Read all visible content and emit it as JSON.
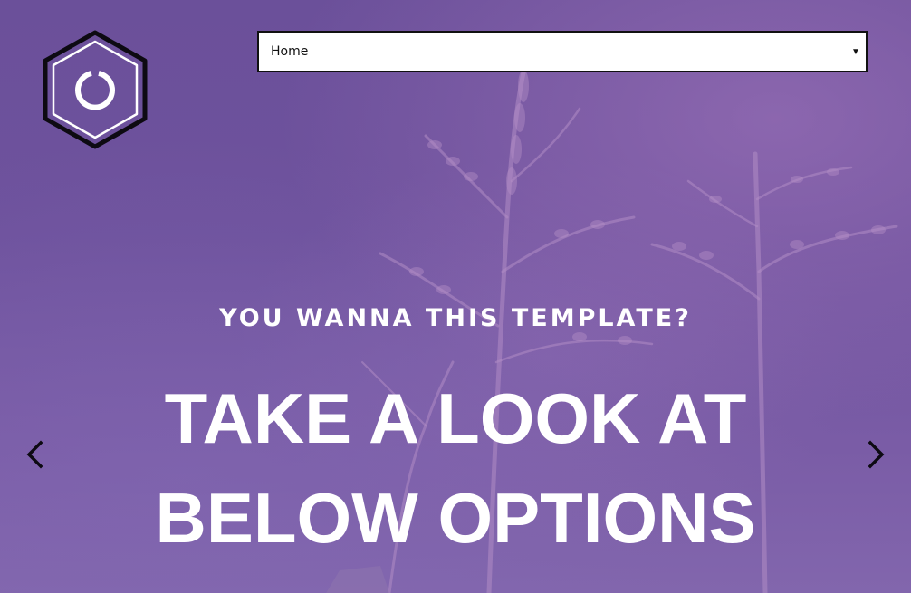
{
  "nav": {
    "selected": "Home",
    "caret": "▼"
  },
  "hero": {
    "eyebrow": "YOU WANNA THIS TEMPLATE?",
    "headline": "TAKE A LOOK AT BELOW OPTIONS"
  },
  "icons": {
    "logo": "hexagon-power-logo",
    "prev": "chevron-left-icon",
    "next": "chevron-right-icon"
  },
  "colors": {
    "overlay": "#6b509a",
    "text": "#ffffff",
    "select_bg": "#ffffff",
    "select_border": "#111111"
  }
}
